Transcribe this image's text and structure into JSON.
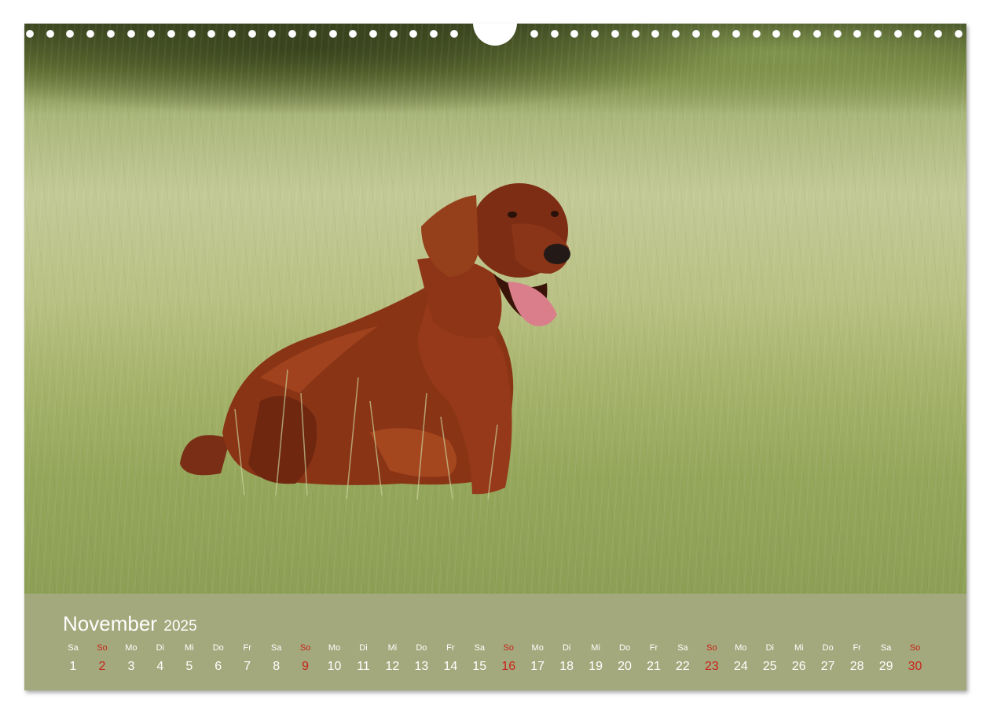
{
  "calendar": {
    "month": "November",
    "year": "2025",
    "weekday_abbrev": [
      "Sa",
      "So",
      "Mo",
      "Di",
      "Mi",
      "Do",
      "Fr",
      "Sa",
      "So",
      "Mo",
      "Di",
      "Mi",
      "Do",
      "Fr",
      "Sa",
      "So",
      "Mo",
      "Di",
      "Mi",
      "Do",
      "Fr",
      "Sa",
      "So",
      "Mo",
      "Di",
      "Mi",
      "Do",
      "Fr",
      "Sa",
      "So"
    ],
    "days": [
      "1",
      "2",
      "3",
      "4",
      "5",
      "6",
      "7",
      "8",
      "9",
      "10",
      "11",
      "12",
      "13",
      "14",
      "15",
      "16",
      "17",
      "18",
      "19",
      "20",
      "21",
      "22",
      "23",
      "24",
      "25",
      "26",
      "27",
      "28",
      "29",
      "30"
    ],
    "sunday_color": "#c8241d",
    "band_color": "#a3a97c",
    "text_color": "#ffffff"
  },
  "photo": {
    "subject": "dog-icon"
  }
}
